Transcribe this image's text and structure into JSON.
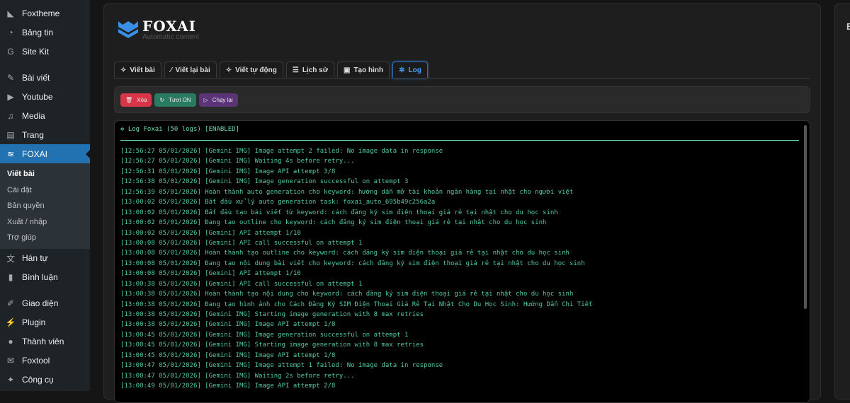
{
  "sidebar": {
    "items": [
      {
        "label": "Foxtheme",
        "icon": "fox-icon"
      },
      {
        "label": "Bảng tin",
        "icon": "dashboard-icon"
      },
      {
        "label": "Site Kit",
        "icon": "google-icon"
      },
      {
        "label": "Bài viết",
        "icon": "pin-icon"
      },
      {
        "label": "Youtube",
        "icon": "youtube-icon"
      },
      {
        "label": "Media",
        "icon": "media-icon"
      },
      {
        "label": "Trang",
        "icon": "page-icon"
      },
      {
        "label": "FOXAI",
        "icon": "foxai-icon"
      }
    ],
    "submenu": [
      "Viết bài",
      "Cài đặt",
      "Bản quyền",
      "Xuất / nhập",
      "Trợ giúp"
    ],
    "items2": [
      {
        "label": "Hán tự",
        "icon": "translate-icon"
      },
      {
        "label": "Bình luận",
        "icon": "comment-icon"
      },
      {
        "label": "Giao diện",
        "icon": "brush-icon"
      },
      {
        "label": "Plugin",
        "icon": "plugin-icon"
      },
      {
        "label": "Thành viên",
        "icon": "user-icon"
      },
      {
        "label": "Foxtool",
        "icon": "foxtool-icon"
      },
      {
        "label": "Công cụ",
        "icon": "wrench-icon"
      }
    ]
  },
  "brand": {
    "name": "FOXAI",
    "tagline": "Automatic content"
  },
  "tabs": [
    "Viết bài",
    "Viết lại bài",
    "Viết tự động",
    "Lịch sử",
    "Tạo hình",
    "Log"
  ],
  "toolbar": {
    "delete": "Xóa",
    "refresh": "Tươi ON",
    "rerun": "Chạy lại"
  },
  "right_panel": {
    "title": "B"
  },
  "log": {
    "header": "Log Foxai (50 logs) [ENABLED]",
    "lines": [
      "[12:56:27 05/01/2026] [Gemini IMG] Image attempt 2 failed: No image data in response",
      "[12:56:27 05/01/2026] [Gemini IMG] Waiting 4s before retry...",
      "[12:56:31 05/01/2026] [Gemini IMG] Image API attempt 3/8",
      "[12:56:38 05/01/2026] [Gemini IMG] Image generation successful on attempt 3",
      "[12:56:39 05/01/2026] Hoàn thành auto generation cho keyword: hướng dẫn mở tài khoản ngân hàng tại nhật cho người việt",
      "[13:00:02 05/01/2026] Bắt đầu xử lý auto generation task: foxai_auto_695b49c256a2a",
      "[13:00:02 05/01/2026] Bắt đầu tạo bài viết từ keyword: cách đăng ký sim điện thoại giá rẻ tại nhật cho du học sinh",
      "[13:00:02 05/01/2026] Đang tạo outline cho keyword: cách đăng ký sim điện thoại giá rẻ tại nhật cho du học sinh",
      "[13:00:02 05/01/2026] [Gemini] API attempt 1/10",
      "[13:00:08 05/01/2026] [Gemini] API call successful on attempt 1",
      "[13:00:08 05/01/2026] Hoàn thành tạo outline cho keyword: cách đăng ký sim điện thoại giá rẻ tại nhật cho du học sinh",
      "[13:00:08 05/01/2026] Đang tạo nội dung bài viết cho keyword: cách đăng ký sim điện thoại giá rẻ tại nhật cho du học sinh",
      "[13:00:08 05/01/2026] [Gemini] API attempt 1/10",
      "[13:00:38 05/01/2026] [Gemini] API call successful on attempt 1",
      "[13:00:38 05/01/2026] Hoàn thành tạo nội dung cho keyword: cách đăng ký sim điện thoại giá rẻ tại nhật cho du học sinh",
      "[13:00:38 05/01/2026] Đang tạo hình ảnh cho Cách Đăng Ký SIM Điện Thoại Giá Rẻ Tại Nhật Cho Du Học Sinh: Hướng Dẫn Chi Tiết",
      "[13:00:38 05/01/2026] [Gemini IMG] Starting image generation with 8 max retries",
      "[13:00:38 05/01/2026] [Gemini IMG] Image API attempt 1/8",
      "[13:00:45 05/01/2026] [Gemini IMG] Image generation successful on attempt 1",
      "[13:00:45 05/01/2026] [Gemini IMG] Starting image generation with 8 max retries",
      "[13:00:45 05/01/2026] [Gemini IMG] Image API attempt 1/8",
      "[13:00:47 05/01/2026] [Gemini IMG] Image attempt 1 failed: No image data in response",
      "[13:00:47 05/01/2026] [Gemini IMG] Waiting 2s before retry...",
      "[13:00:49 05/01/2026] [Gemini IMG] Image API attempt 2/8"
    ]
  },
  "colors": {
    "accent": "#2271b1",
    "delete": "#d63645",
    "refresh": "#2a7a62",
    "rerun": "#5a3477",
    "log_text": "#52c9a0"
  }
}
